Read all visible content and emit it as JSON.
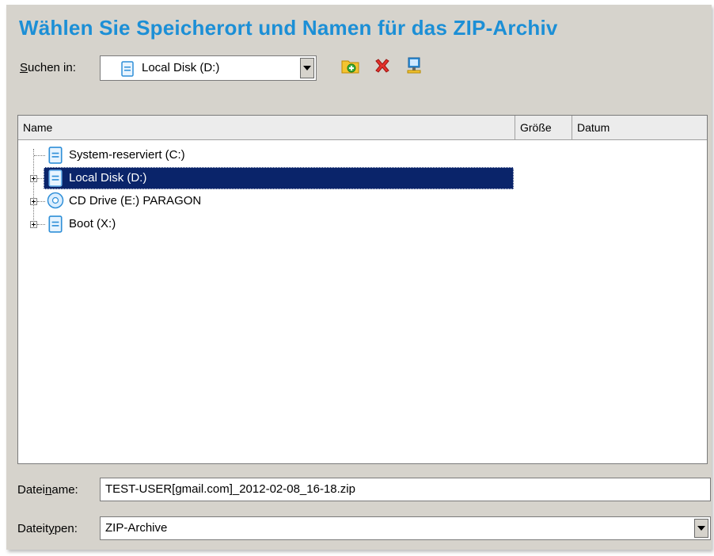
{
  "title": "Wählen Sie Speicherort und Namen für das ZIP-Archiv",
  "lookin": {
    "label_prefix": "S",
    "label_rest": "uchen in:",
    "value": "Local Disk (D:)"
  },
  "toolbar": {
    "icons": [
      "new-folder-icon",
      "delete-icon",
      "network-drive-icon"
    ]
  },
  "columns": [
    "Name",
    "Größe",
    "Datum"
  ],
  "tree": [
    {
      "label": "System-reserviert (C:)",
      "icon": "drive-icon",
      "expandable": false,
      "selected": false
    },
    {
      "label": "Local Disk (D:)",
      "icon": "drive-icon",
      "expandable": true,
      "selected": true
    },
    {
      "label": "CD Drive (E:) PARAGON",
      "icon": "cd-icon",
      "expandable": true,
      "selected": false
    },
    {
      "label": "Boot (X:)",
      "icon": "drive-icon",
      "expandable": true,
      "selected": false
    }
  ],
  "filename": {
    "label_a": "Datei",
    "label_u": "n",
    "label_b": "ame:",
    "value": "TEST-USER[gmail.com]_2012-02-08_16-18.zip"
  },
  "filetype": {
    "label_a": "Dateit",
    "label_u": "y",
    "label_b": "pen:",
    "value": "ZIP-Archive"
  },
  "colors": {
    "title": "#1c8fd6",
    "selection": "#0a246a",
    "dialog_bg": "#d6d3cc"
  }
}
